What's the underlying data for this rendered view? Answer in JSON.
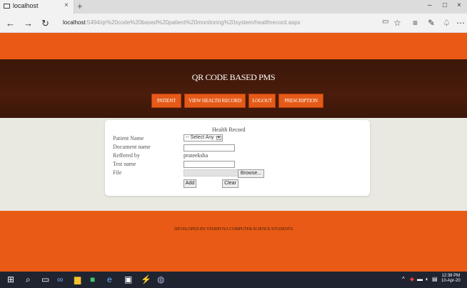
{
  "browser": {
    "tab_title": "localhost",
    "tab_close": "×",
    "new_tab": "+",
    "minimize": "–",
    "maximize": "□",
    "close": "×",
    "url_host": "localhost",
    "url_rest": ":5494/qr%20code%20based%20patient%20monitoring%20system/healthrecord.aspx"
  },
  "site": {
    "title": "QR CODE BASED PMS",
    "nav": [
      "PATIENT",
      "VIEW HEALTH RECORD",
      "LOGOUT",
      "PRESCRIPTION"
    ]
  },
  "form": {
    "title": "Health Record",
    "labels": {
      "patient_name": "Patient Name",
      "document_name": "Document name",
      "reffered_by": "Reffered by",
      "test_name": "Test name",
      "file": "File"
    },
    "patient_select_value": "-- Select Any --",
    "reffered_by_value": "prateeksha",
    "document_name_value": "",
    "test_name_value": "",
    "browse_label": "Browse...",
    "add_label": "Add",
    "clear_label": "Clear"
  },
  "footer": {
    "text": "DEVELOPED BY YENEPOYA COMPUTER SCIENCE STUDENTS"
  },
  "taskbar": {
    "time": "12:38 PM",
    "date": "10-Apr-20"
  },
  "colors": {
    "orange": "#ea5a15",
    "dark_header": "#3a1509",
    "content_bg": "#e9e9e2"
  }
}
